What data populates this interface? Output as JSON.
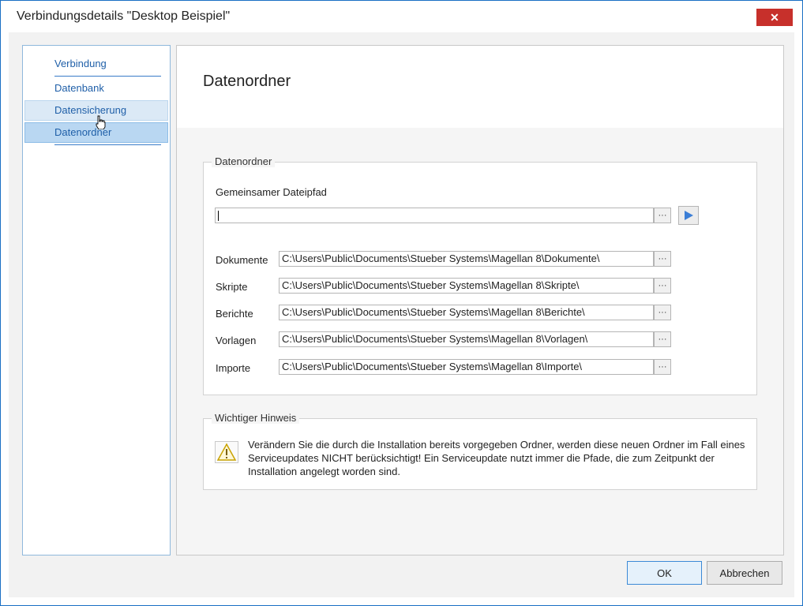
{
  "window": {
    "title": "Verbindungsdetails \"Desktop Beispiel\"",
    "close_glyph": "✕"
  },
  "sidebar": {
    "items": [
      {
        "label": "Verbindung",
        "state": "normal"
      },
      {
        "label": "Datenbank",
        "state": "normal"
      },
      {
        "label": "Datensicherung",
        "state": "hover"
      },
      {
        "label": "Datenordner",
        "state": "selected"
      }
    ]
  },
  "content": {
    "heading": "Datenordner",
    "folders_group": {
      "legend": "Datenordner",
      "shared_path_label": "Gemeinsamer Dateipfad",
      "shared_path_value": "",
      "browse_label": "···",
      "rows": [
        {
          "label": "Dokumente",
          "value": "C:\\Users\\Public\\Documents\\Stueber Systems\\Magellan 8\\Dokumente\\"
        },
        {
          "label": "Skripte",
          "value": "C:\\Users\\Public\\Documents\\Stueber Systems\\Magellan 8\\Skripte\\"
        },
        {
          "label": "Berichte",
          "value": "C:\\Users\\Public\\Documents\\Stueber Systems\\Magellan 8\\Berichte\\"
        },
        {
          "label": "Vorlagen",
          "value": "C:\\Users\\Public\\Documents\\Stueber Systems\\Magellan 8\\Vorlagen\\"
        },
        {
          "label": "Importe",
          "value": "C:\\Users\\Public\\Documents\\Stueber Systems\\Magellan 8\\Importe\\"
        }
      ]
    },
    "notice_group": {
      "legend": "Wichtiger Hinweis",
      "text": "Verändern Sie die durch die Installation bereits vorgegeben Ordner, werden diese neuen Ordner im Fall eines Serviceupdates NICHT berücksichtigt! Ein Serviceupdate nutzt immer die Pfade, die zum Zeitpunkt der Installation angelegt worden sind."
    }
  },
  "footer": {
    "ok_label": "OK",
    "cancel_label": "Abbrechen"
  },
  "colors": {
    "accent": "#1f5fa8",
    "close_button": "#c7302b",
    "play_icon": "#3b7ed6"
  }
}
